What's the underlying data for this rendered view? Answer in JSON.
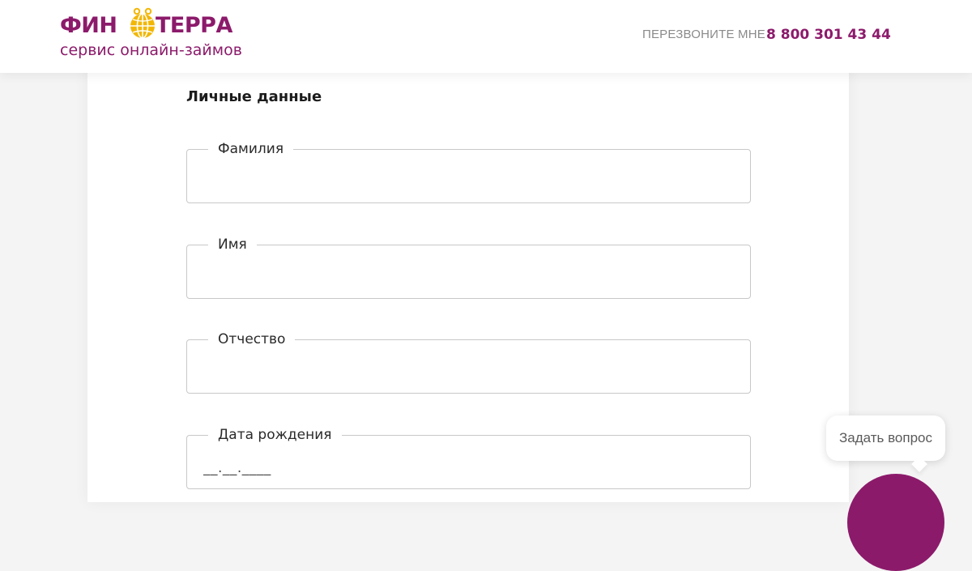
{
  "header": {
    "logo_left": "ФИН",
    "logo_right": "ТЕРРА",
    "logo_tagline": "сервис онлайн-займов",
    "callback_label": "ПЕРЕЗВОНИТЕ МНЕ",
    "phone": "8 800 301 43 44"
  },
  "form": {
    "section_title": "Личные данные",
    "fields": [
      {
        "label": "Фамилия",
        "value": "",
        "placeholder": ""
      },
      {
        "label": "Имя",
        "value": "",
        "placeholder": ""
      },
      {
        "label": "Отчество",
        "value": "",
        "placeholder": ""
      },
      {
        "label": "Дата рождения",
        "value": "",
        "placeholder": "__.__.____"
      }
    ]
  },
  "chat": {
    "ask_label": "Задать вопрос"
  },
  "colors": {
    "brand": "#8c1a6b",
    "accent": "#f2b705"
  },
  "icons": {
    "logo_globe": "globe-icon"
  }
}
